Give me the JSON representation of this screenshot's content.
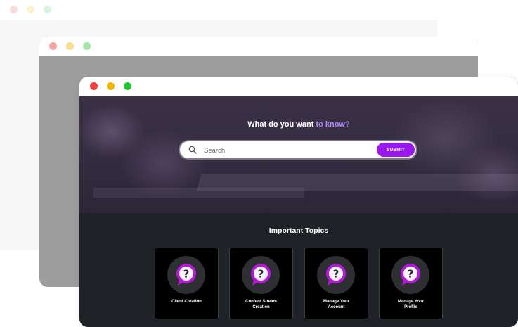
{
  "window_controls": {
    "back": [
      "#fbdada",
      "#fdf1c9",
      "#d9f6dc"
    ],
    "middle": [
      "#f5a6a4",
      "#f8dd8f",
      "#a3e7a8"
    ],
    "front": [
      "#f13f3f",
      "#f5b400",
      "#1fc934"
    ]
  },
  "hero": {
    "title_main": "What do you want ",
    "title_accent": "to know?",
    "accent_color": "#b28cff"
  },
  "search": {
    "placeholder": "Search",
    "icon": "search-icon",
    "submit_label": "SUBMIT",
    "submit_color": "#9b17f0"
  },
  "topics": {
    "title": "Important Topics",
    "icon": "question-bubble-icon",
    "items": [
      {
        "label": "Client Creation"
      },
      {
        "label": "Content Stream\nCreation"
      },
      {
        "label": "Manage Your\nAccount"
      },
      {
        "label": "Manage Your\nProfile"
      }
    ]
  }
}
